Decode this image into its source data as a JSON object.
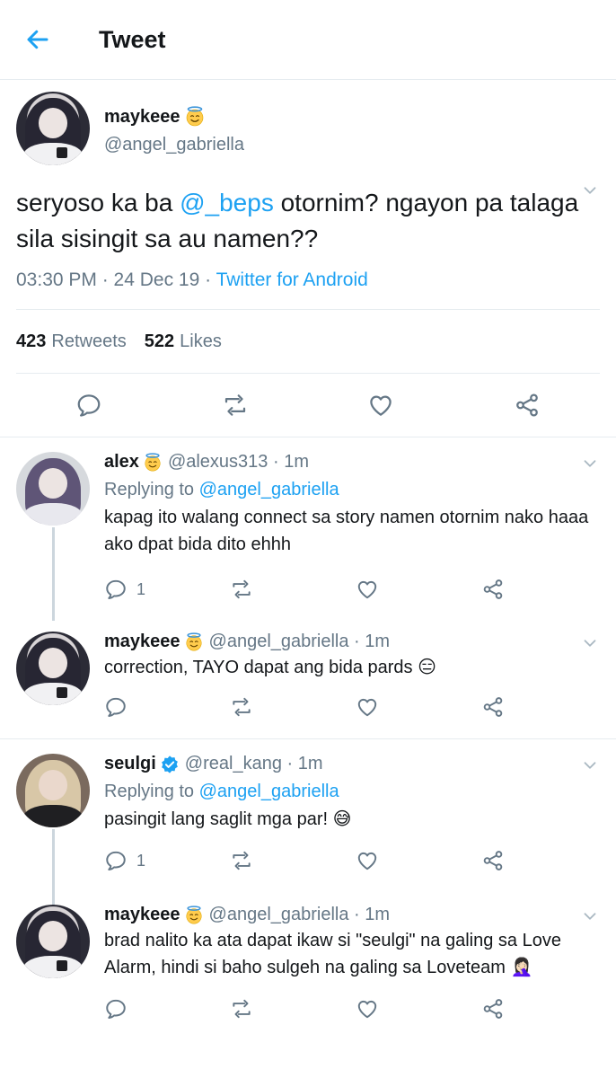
{
  "header": {
    "title": "Tweet"
  },
  "main_tweet": {
    "name": "maykeee",
    "handle": "@angel_gabriella",
    "text_before": "seryoso ka ba ",
    "mention": "@_beps",
    "text_after": " otornim? ngayon pa talaga sila sisingit sa au namen??",
    "time": "03:30 PM · 24 Dec 19 · ",
    "source": "Twitter for Android",
    "retweets": "423",
    "retweets_label": "Retweets",
    "likes": "522",
    "likes_label": "Likes"
  },
  "replies": [
    {
      "name": "alex",
      "handle": "@alexus313 · 1m",
      "replying_prefix": "Replying to ",
      "replying_to": "@angel_gabriella",
      "text": "kapag ito walang connect sa story namen otornim nako haaa ako dpat bida dito ehhh",
      "reply_count": "1"
    },
    {
      "name": "maykeee",
      "handle": "@angel_gabriella · 1m",
      "text": "correction, TAYO dapat ang bida pards 😑"
    },
    {
      "name": "seulgi",
      "handle": "@real_kang · 1m",
      "replying_prefix": "Replying to ",
      "replying_to": "@angel_gabriella",
      "text": "pasingit lang saglit mga par! 😅",
      "reply_count": "1"
    },
    {
      "name": "maykeee",
      "handle": "@angel_gabriella · 1m",
      "text": "brad nalito ka ata dapat ikaw si \"seulgi\" na galing sa Love Alarm, hindi si baho sulgeh na galing sa Loveteam 🤦🏻‍♀️"
    }
  ],
  "colors": {
    "accent": "#1da1f2",
    "muted": "#657786",
    "divider": "#e6ecf0"
  },
  "icons": [
    "back-arrow-icon",
    "halo-emoji-icon",
    "chevron-down-icon",
    "reply-icon",
    "retweet-icon",
    "like-icon",
    "share-icon",
    "verified-badge-icon"
  ]
}
